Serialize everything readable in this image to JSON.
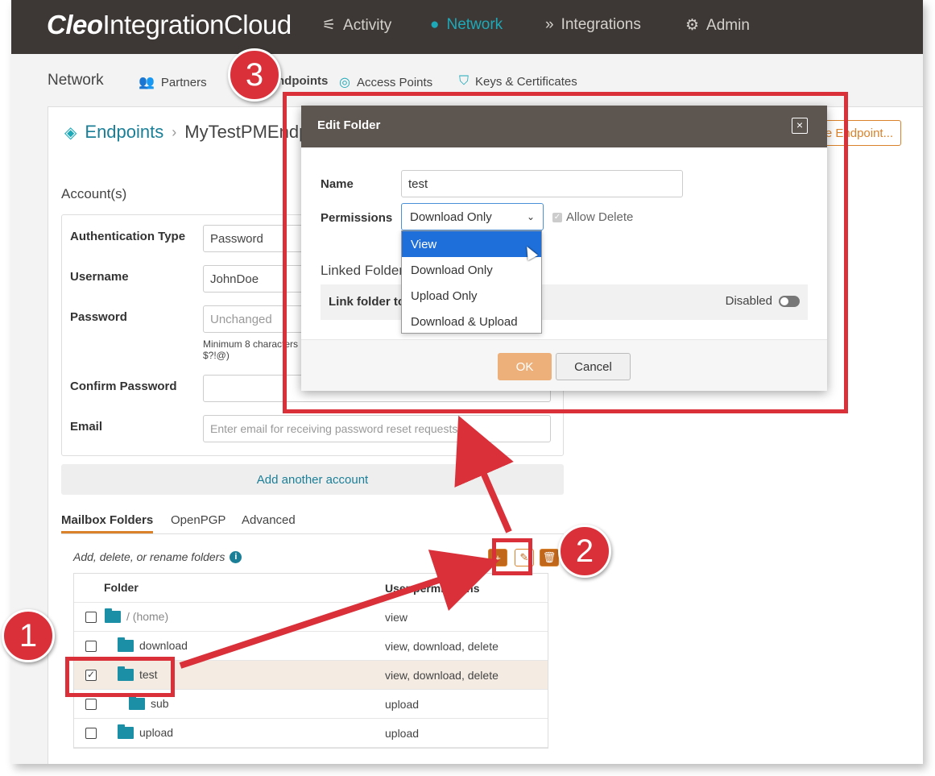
{
  "app": {
    "logo_bold": "Cleo",
    "logo_rest": "IntegrationCloud",
    "nav": [
      {
        "label": "Activity",
        "icon": "activity-icon"
      },
      {
        "label": "Network",
        "icon": "network-icon",
        "active": true
      },
      {
        "label": "Integrations",
        "icon": "integrations-icon"
      },
      {
        "label": "Admin",
        "icon": "gear-icon"
      }
    ]
  },
  "subnav": {
    "title": "Network",
    "items": [
      {
        "label": "Partners",
        "icon": "partners-icon"
      },
      {
        "label": "Endpoints",
        "icon": "endpoints-icon"
      },
      {
        "label": "Access Points",
        "icon": "access-points-icon"
      },
      {
        "label": "Keys & Certificates",
        "icon": "shield-icon"
      }
    ]
  },
  "breadcrumb": {
    "root": "Endpoints",
    "current": "MyTestPMEndpoint"
  },
  "endpoint_button": "e Endpoint...",
  "accounts": {
    "section": "Account(s)",
    "auth_label": "Authentication Type",
    "auth_value": "Password",
    "username_label": "Username",
    "username_value": "JohnDoe",
    "password_label": "Password",
    "password_placeholder": "Unchanged",
    "password_hint_1": "Minimum 8 characters",
    "password_hint_2": "$?!@)",
    "confirm_label": "Confirm Password",
    "email_label": "Email",
    "email_placeholder": "Enter email for receiving password reset requests",
    "add_account": "Add another account"
  },
  "folder_tabs": [
    "Mailbox Folders",
    "OpenPGP",
    "Advanced"
  ],
  "folders": {
    "help": "Add, delete, or rename folders",
    "col_folder": "Folder",
    "col_perm": "User permissions",
    "rows": [
      {
        "name": "/ (home)",
        "perm": "view",
        "checked": false,
        "indent": 0
      },
      {
        "name": "download",
        "perm": "view, download, delete",
        "checked": false,
        "indent": 1
      },
      {
        "name": "test",
        "perm": "view, download, delete",
        "checked": true,
        "indent": 1
      },
      {
        "name": "sub",
        "perm": "upload",
        "checked": false,
        "indent": 2
      },
      {
        "name": "upload",
        "perm": "upload",
        "checked": false,
        "indent": 1
      }
    ]
  },
  "modal": {
    "title": "Edit Folder",
    "close": "×",
    "name_label": "Name",
    "name_value": "test",
    "perm_label": "Permissions",
    "perm_value": "Download Only",
    "allow_delete": "Allow Delete",
    "linked_title": "Linked Folder",
    "link_label": "Link folder to",
    "link_status": "Disabled",
    "ok": "OK",
    "cancel": "Cancel",
    "options": [
      "View",
      "Download Only",
      "Upload Only",
      "Download & Upload"
    ],
    "highlighted_option": "View"
  },
  "callouts": [
    "1",
    "2",
    "3"
  ],
  "colors": {
    "accent": "#1da9b8",
    "brand_orange": "#d9822b",
    "callout_red": "#d9303a",
    "topbar": "#3d3835"
  }
}
